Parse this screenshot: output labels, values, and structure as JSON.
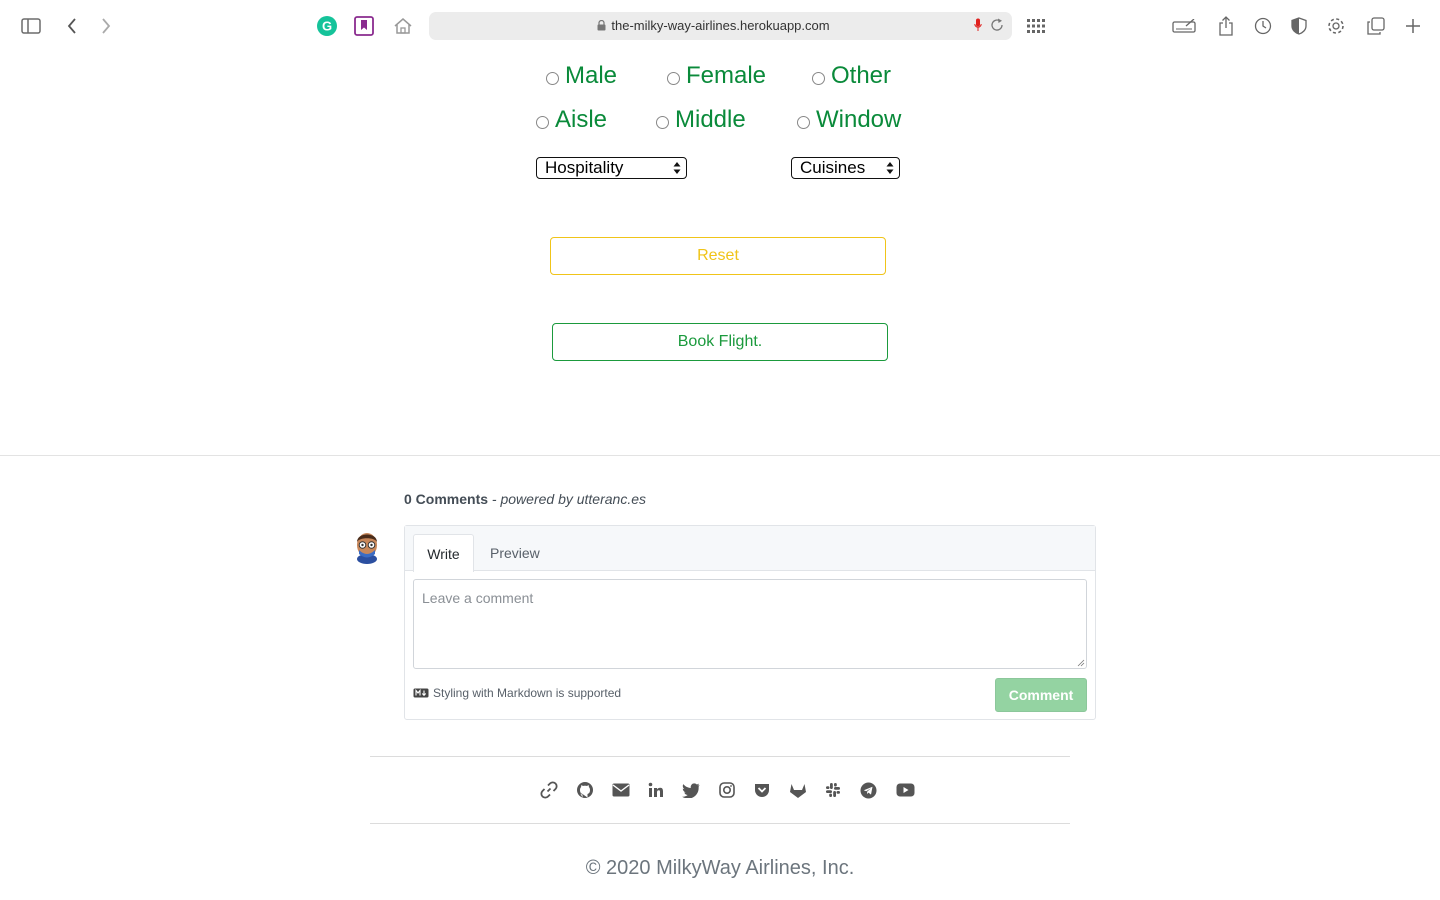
{
  "browser": {
    "url": "the-milky-way-airlines.herokuapp.com",
    "icons": [
      "sidebar-icon",
      "back-icon",
      "forward-icon",
      "grammarly-icon",
      "bookmark-icon",
      "home-icon",
      "grid-icon",
      "keyboard-icon",
      "share-icon",
      "history-icon",
      "shield-icon",
      "gear-icon",
      "tabs-icon",
      "plus-icon"
    ]
  },
  "form": {
    "gender": [
      "Male",
      "Female",
      "Other"
    ],
    "seat": [
      "Aisle",
      "Middle",
      "Window"
    ],
    "hospitality_select": "Hospitality",
    "cuisines_select": "Cuisines",
    "reset_label": "Reset",
    "book_label": "Book Flight."
  },
  "comments": {
    "count_label": "0 Comments",
    "powered_by": "- powered by utteranc.es",
    "tab_write": "Write",
    "tab_preview": "Preview",
    "placeholder": "Leave a comment",
    "markdown_note": "Styling with Markdown is supported",
    "comment_button": "Comment"
  },
  "footer": {
    "social_icons": [
      "link-icon",
      "github-icon",
      "email-icon",
      "linkedin-icon",
      "twitter-icon",
      "instagram-icon",
      "pocket-icon",
      "gitlab-icon",
      "slack-icon",
      "telegram-icon",
      "youtube-icon"
    ],
    "copyright": "© 2020 MilkyWay Airlines, Inc."
  },
  "colors": {
    "accent_green": "#0a8a3a",
    "reset_yellow": "#f0c419",
    "comment_button": "#94d3a2"
  }
}
